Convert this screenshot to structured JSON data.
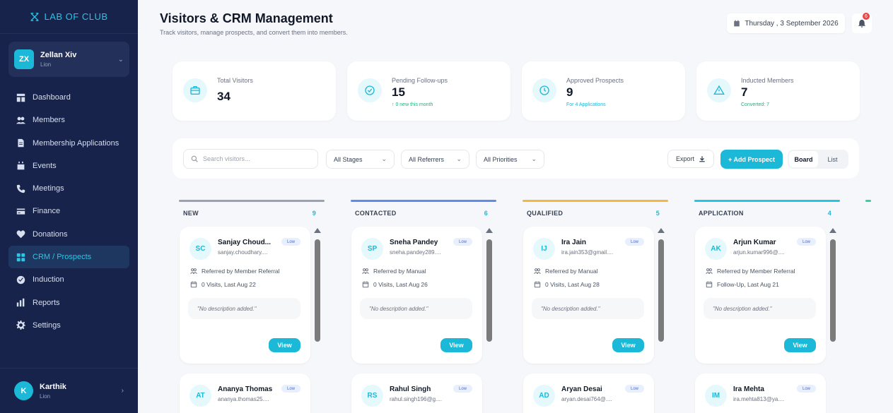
{
  "sidebar": {
    "logo_text": "LAB OF CLUB",
    "account": {
      "initials": "ZX",
      "name": "Zellan Xiv",
      "role": "Lion"
    },
    "items": [
      {
        "label": "Dashboard"
      },
      {
        "label": "Members"
      },
      {
        "label": "Membership Applications"
      },
      {
        "label": "Events"
      },
      {
        "label": "Meetings"
      },
      {
        "label": "Finance"
      },
      {
        "label": "Donations"
      },
      {
        "label": "CRM / Prospects"
      },
      {
        "label": "Induction"
      },
      {
        "label": "Reports"
      },
      {
        "label": "Settings"
      }
    ],
    "active_item": "CRM / Prospects",
    "user": {
      "initial": "K",
      "name": "Karthik",
      "role": "Lion"
    }
  },
  "header": {
    "title": "Visitors & CRM Management",
    "subtitle": "Track visitors, manage prospects, and convert them into members.",
    "date": "Thursday , 3 September 2026",
    "notification_count": "6"
  },
  "stats": [
    {
      "label": "Total Visitors",
      "value": "34",
      "sub": ""
    },
    {
      "label": "Pending Follow-ups",
      "value": "15",
      "sub": "↑ 0 new this month"
    },
    {
      "label": "Approved Prospects",
      "value": "9",
      "sub": "For 4 Applications"
    },
    {
      "label": "Inducted Members",
      "value": "7",
      "sub": "Converted: 7"
    }
  ],
  "toolbar": {
    "search_placeholder": "Search visitors...",
    "stage_filter": "All Stages",
    "referrer_filter": "All Referrers",
    "priority_filter": "All Priorities",
    "export_label": "Export",
    "add_label": "+ Add Prospect",
    "view_board": "Board",
    "view_list": "List"
  },
  "columns": [
    {
      "name": "NEW",
      "count": "9",
      "color": "#9aa1b2",
      "cards": [
        {
          "initials": "SC",
          "name": "Sanjay Choud...",
          "email": "sanjay.choudhary....",
          "priority": "Low",
          "referred": "Referred by Member Referral",
          "visits": "0 Visits, Last Aug 22",
          "desc": "\"No description added.\"",
          "view": "View"
        },
        {
          "initials": "AT",
          "name": "Ananya Thomas",
          "email": "ananya.thomas25....",
          "priority": "Low"
        }
      ]
    },
    {
      "name": "CONTACTED",
      "count": "6",
      "color": "#5b8def",
      "cards": [
        {
          "initials": "SP",
          "name": "Sneha Pandey",
          "email": "sneha.pandey289....",
          "priority": "Low",
          "referred": "Referred by Manual",
          "visits": "0 Visits, Last Aug 26",
          "desc": "\"No description added.\"",
          "view": "View"
        },
        {
          "initials": "RS",
          "name": "Rahul Singh",
          "email": "rahul.singh196@g....",
          "priority": "Low"
        }
      ]
    },
    {
      "name": "QUALIFIED",
      "count": "5",
      "color": "#f6b73c",
      "cards": [
        {
          "initials": "IJ",
          "name": "Ira Jain",
          "email": "ira.jain353@gmail....",
          "priority": "Low",
          "referred": "Referred by Manual",
          "visits": "0 Visits, Last Aug 28",
          "desc": "\"No description added.\"",
          "view": "View"
        },
        {
          "initials": "AD",
          "name": "Aryan Desai",
          "email": "aryan.desai764@....",
          "priority": "Low"
        }
      ]
    },
    {
      "name": "APPLICATION",
      "count": "4",
      "color": "#22c7e5",
      "cards": [
        {
          "initials": "AK",
          "name": "Arjun Kumar",
          "email": "arjun.kumar996@....",
          "priority": "Low",
          "referred": "Referred by Member Referral",
          "visits": "Follow-Up, Last Aug 21",
          "desc": "\"No description added.\"",
          "view": "View"
        },
        {
          "initials": "IM",
          "name": "Ira Mehta",
          "email": "ira.mehta813@ya....",
          "priority": "Low"
        }
      ]
    }
  ],
  "partial_column_color": "#34d399"
}
